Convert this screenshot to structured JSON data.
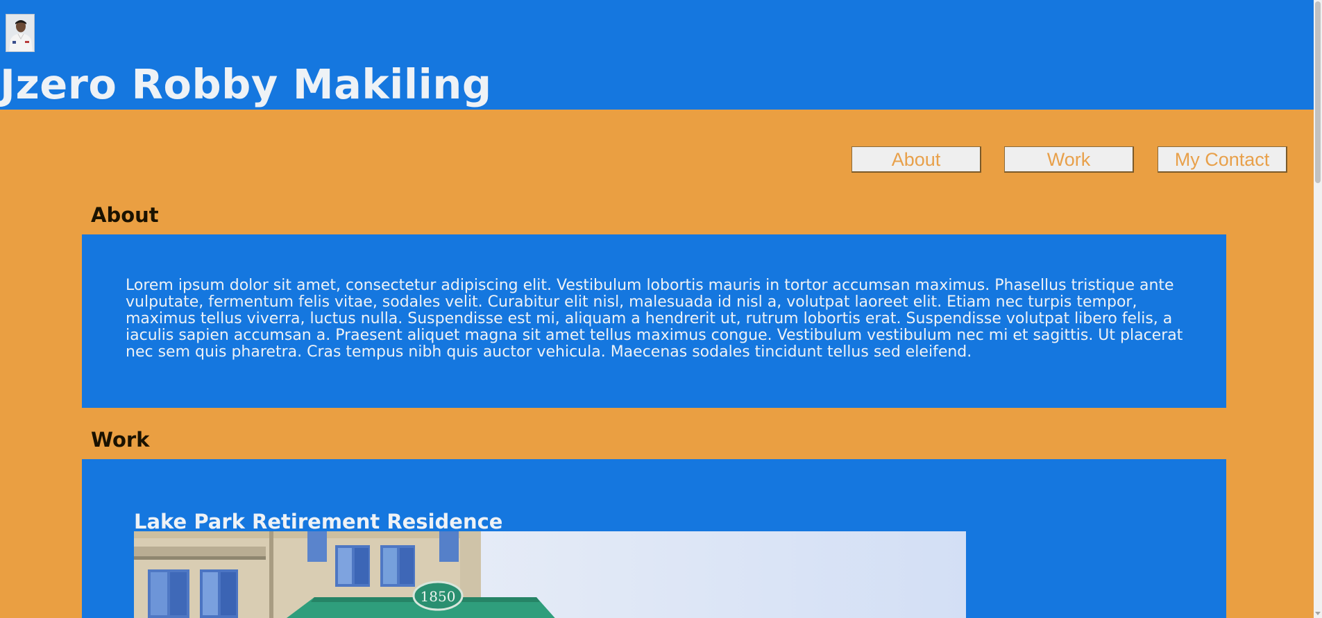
{
  "header": {
    "site_title": "Jzero Robby Makiling",
    "avatar": "profile-photo"
  },
  "nav": {
    "items": [
      {
        "label": "About"
      },
      {
        "label": "Work"
      },
      {
        "label": "My Contact"
      }
    ]
  },
  "about": {
    "heading": "About",
    "text": "Lorem ipsum dolor sit amet, consectetur adipiscing elit. Vestibulum lobortis mauris in tortor accumsan maximus. Phasellus tristique ante vulputate, fermentum felis vitae, sodales velit. Curabitur elit nisl, malesuada id nisl a, volutpat laoreet elit. Etiam nec turpis tempor, maximus tellus viverra, luctus nulla. Suspendisse est mi, aliquam a hendrerit ut, rutrum lobortis erat. Suspendisse volutpat libero felis, a iaculis sapien accumsan a. Praesent aliquet magna sit amet tellus maximus congue. Vestibulum vestibulum nec mi et sagittis. Ut placerat nec sem quis pharetra. Cras tempus nibh quis auctor vehicula. Maecenas sodales tincidunt tellus sed eleifend."
  },
  "work": {
    "heading": "Work",
    "projects": [
      {
        "title": "Lake Park Retirement Residence",
        "sign_number": "1850"
      }
    ]
  },
  "colors": {
    "page_background": "#ea9f42",
    "header_background": "#1577df",
    "panel_background": "#1577df",
    "nav_text": "#e8a04a"
  }
}
